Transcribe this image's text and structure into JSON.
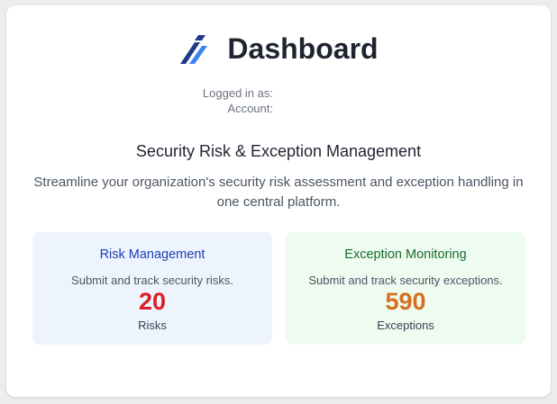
{
  "header": {
    "title": "Dashboard",
    "logo_icon": "diagonal-slashes-logo-icon"
  },
  "user": {
    "logged_in_label": "Logged in as:",
    "account_label": "Account:"
  },
  "intro": {
    "subtitle": "Security Risk & Exception Management",
    "description": "Streamline your organization's security risk assessment and exception handling in one central platform."
  },
  "risk_panel": {
    "title": "Risk Management",
    "description": "Submit and track security risks.",
    "count": "20",
    "unit": "Risks",
    "colors": {
      "title": "#1d3fb3",
      "count": "#dc1f26",
      "background": "#eef4fd"
    }
  },
  "exception_panel": {
    "title": "Exception Monitoring",
    "description": "Submit and track security exceptions.",
    "count": "590",
    "unit": "Exceptions",
    "colors": {
      "title": "#1a6b2b",
      "count": "#d4701c",
      "background": "#eefbf1"
    }
  }
}
